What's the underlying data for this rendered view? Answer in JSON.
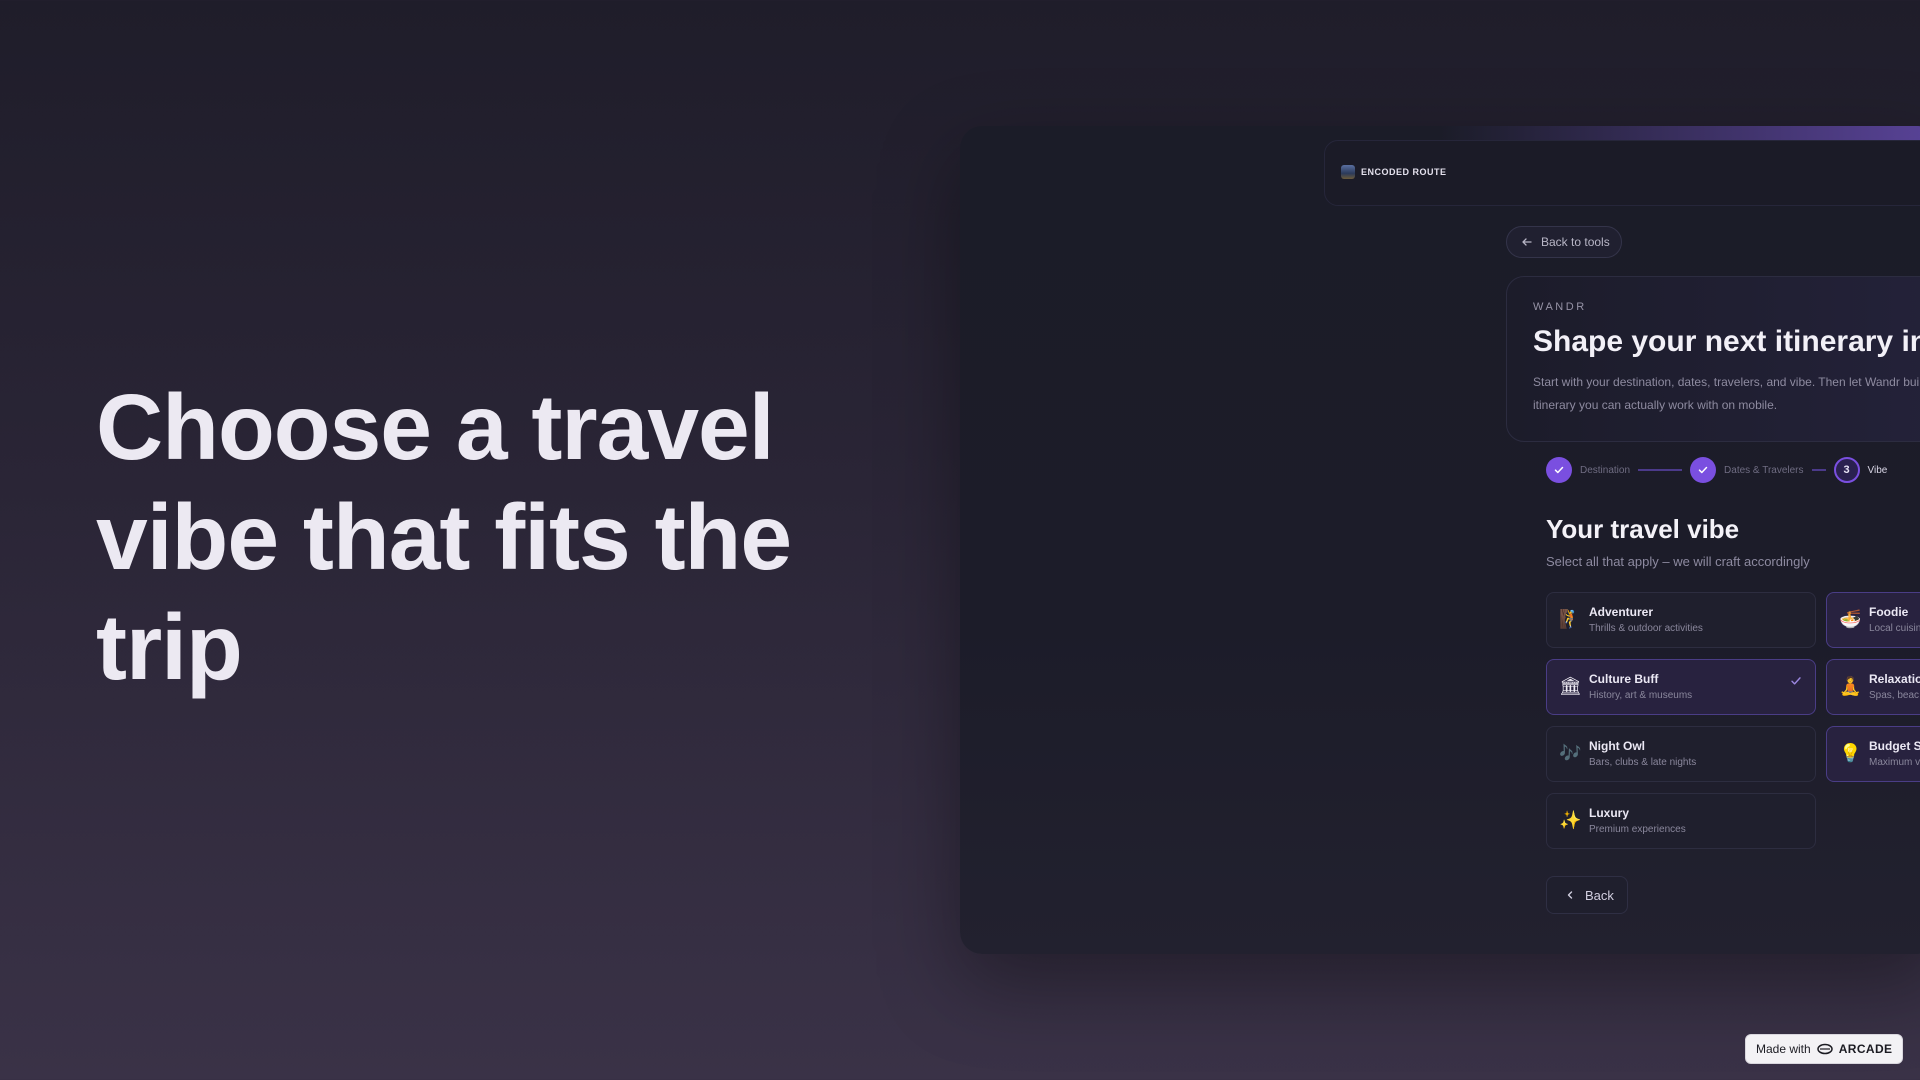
{
  "headline": {
    "lines": [
      "Choose a travel",
      "vibe that fits the",
      "trip"
    ]
  },
  "app": {
    "logo_text": "ENCODED ROUTE",
    "back_to_tools": "Back to tools",
    "eyebrow": "WANDR",
    "hero_title": "Shape your next itinerary in a",
    "hero_desc_line1": "Start with your destination, dates, travelers, and vibe. Then let Wandr build",
    "hero_desc_line2": "itinerary you can actually work with on mobile."
  },
  "stepper": {
    "steps": [
      {
        "label": "Destination",
        "state": "done"
      },
      {
        "label": "Dates & Travelers",
        "state": "done"
      },
      {
        "label": "Vibe",
        "number": "3",
        "state": "current"
      }
    ]
  },
  "vibe_section": {
    "title": "Your travel vibe",
    "subtitle": "Select all that apply – we will craft accordingly",
    "options": [
      {
        "name": "Adventurer",
        "desc": "Thrills & outdoor activities",
        "icon": "adventurer-icon",
        "selected": false
      },
      {
        "name": "Foodie",
        "desc": "Local cuisin",
        "icon": "foodie-icon",
        "selected": true
      },
      {
        "name": "Culture Buff",
        "desc": "History, art & museums",
        "icon": "museum-icon",
        "selected": true
      },
      {
        "name": "Relaxatio",
        "desc": "Spas, beac",
        "icon": "relaxation-icon",
        "selected": true
      },
      {
        "name": "Night Owl",
        "desc": "Bars, clubs & late nights",
        "icon": "night-owl-icon",
        "selected": false
      },
      {
        "name": "Budget S",
        "desc": "Maximum v",
        "icon": "budget-icon",
        "selected": true
      },
      {
        "name": "Luxury",
        "desc": "Premium experiences",
        "icon": "sparkles-icon",
        "selected": false
      }
    ],
    "back_label": "Back"
  },
  "badge": {
    "made_with": "Made with",
    "brand": "ARCADE"
  },
  "colors": {
    "accent": "#7a4fe0",
    "selected_card": "#28223f",
    "background": "#2a2536"
  }
}
